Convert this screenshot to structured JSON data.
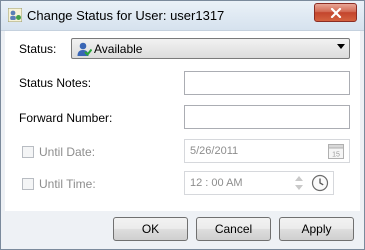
{
  "window": {
    "title": "Change Status for User: user1317"
  },
  "form": {
    "status_label": "Status:",
    "status_value": "Available",
    "status_notes_label": "Status Notes:",
    "status_notes_value": "",
    "forward_number_label": "Forward Number:",
    "forward_number_value": "",
    "until_date_label": "Until Date:",
    "until_date_value": "5/26/2011",
    "until_date_checked": false,
    "until_time_label": "Until Time:",
    "until_time_value": "12 : 00  AM",
    "until_time_checked": false
  },
  "buttons": {
    "ok": "OK",
    "cancel": "Cancel",
    "apply": "Apply"
  },
  "icons": {
    "app": "user-status-icon",
    "close": "close-icon",
    "available": "user-available-icon",
    "dropdown": "chevron-down-icon",
    "calendar": "calendar-icon",
    "spinner": "spinner-arrows-icon",
    "clock": "clock-icon"
  },
  "colors": {
    "close_button": "#c3452d",
    "disabled_text": "#8d8d8d"
  }
}
